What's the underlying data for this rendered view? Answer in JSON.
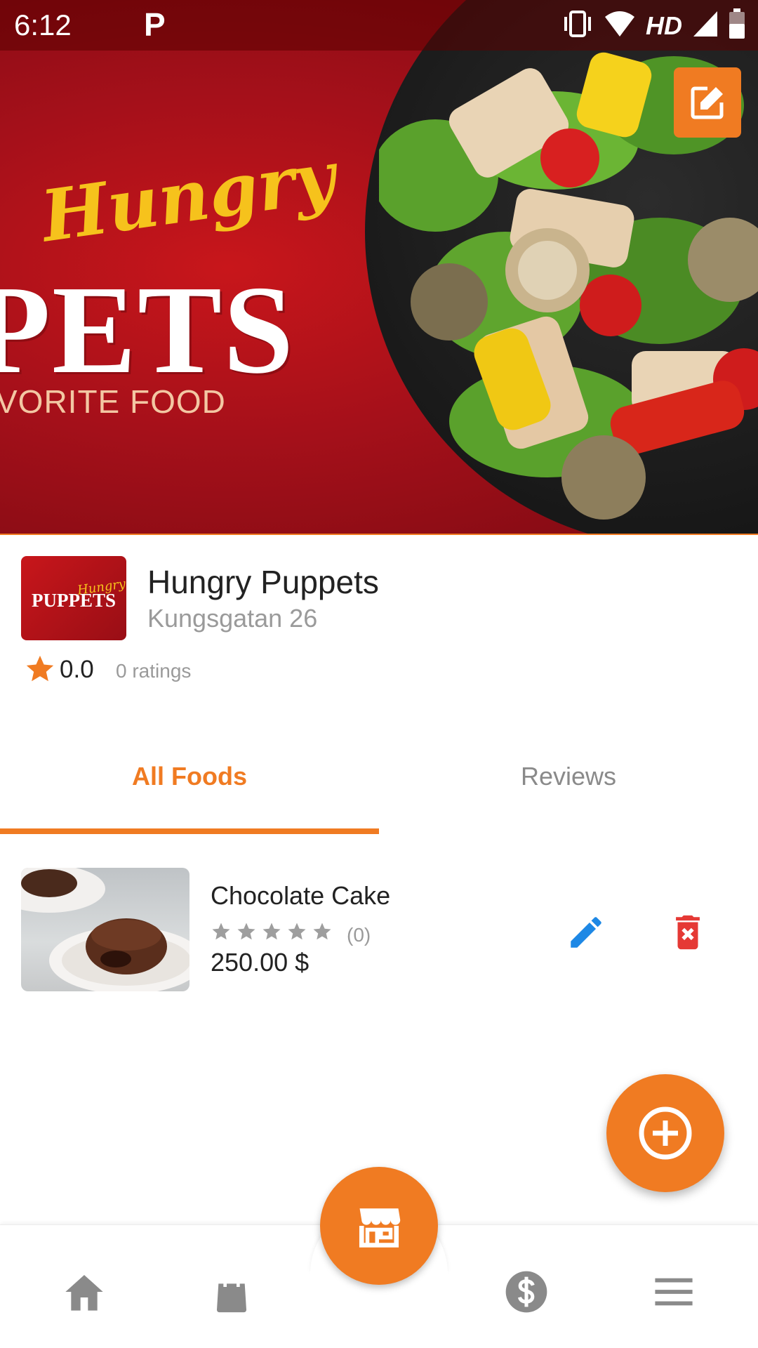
{
  "status_bar": {
    "time": "6:12",
    "app_indicator": "P",
    "network_label": "HD",
    "icons": [
      "vibrate-icon",
      "wifi-icon",
      "cell-signal-icon",
      "battery-icon"
    ]
  },
  "hero": {
    "script_text": "Hungry",
    "big_text": "PETS",
    "tagline": "VORITE FOOD",
    "edit_icon": "edit-square-icon"
  },
  "store": {
    "logo_script": "Hungry",
    "logo_text": "PUPPETS",
    "name": "Hungry Puppets",
    "address": "Kungsgatan 26",
    "rating": "0.0",
    "rating_count": "0 ratings"
  },
  "tabs": [
    {
      "label": "All Foods",
      "active": true
    },
    {
      "label": "Reviews",
      "active": false
    }
  ],
  "foods": [
    {
      "name": "Chocolate Cake",
      "stars": 0,
      "rating_count": "(0)",
      "price": "250.00 $"
    }
  ],
  "fab": {
    "icon": "add-circle-icon"
  },
  "bottom_nav": {
    "items": [
      "home-icon",
      "shopping-bag-icon",
      "store-icon",
      "dollar-icon",
      "menu-icon"
    ],
    "active": "store-icon"
  },
  "colors": {
    "accent": "#f07b22",
    "hero_red": "#a5101a",
    "edit_blue": "#1e88e5",
    "delete_red": "#e53935",
    "nav_icon_gray": "#8a8a8a"
  }
}
